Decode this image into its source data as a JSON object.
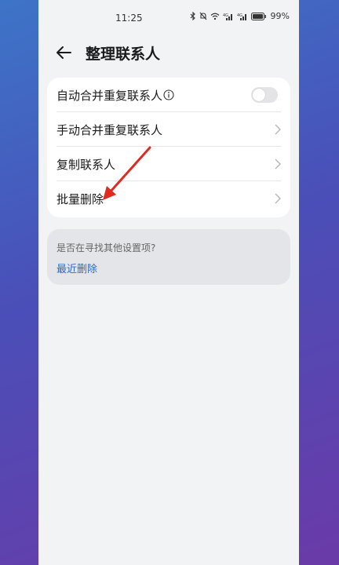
{
  "status_bar": {
    "time": "11:25",
    "battery": "99%"
  },
  "header": {
    "title": "整理联系人"
  },
  "settings": {
    "rows": [
      {
        "label": "自动合并重复联系人",
        "control": "toggle",
        "toggle_on": false,
        "has_info": true
      },
      {
        "label": "手动合并重复联系人",
        "control": "chevron"
      },
      {
        "label": "复制联系人",
        "control": "chevron"
      },
      {
        "label": "批量删除",
        "control": "chevron"
      }
    ]
  },
  "suggestion": {
    "question": "是否在寻找其他设置项?",
    "link": "最近删除"
  },
  "colors": {
    "accent_link": "#2e68c7",
    "annotation_arrow": "#e02a1f"
  }
}
